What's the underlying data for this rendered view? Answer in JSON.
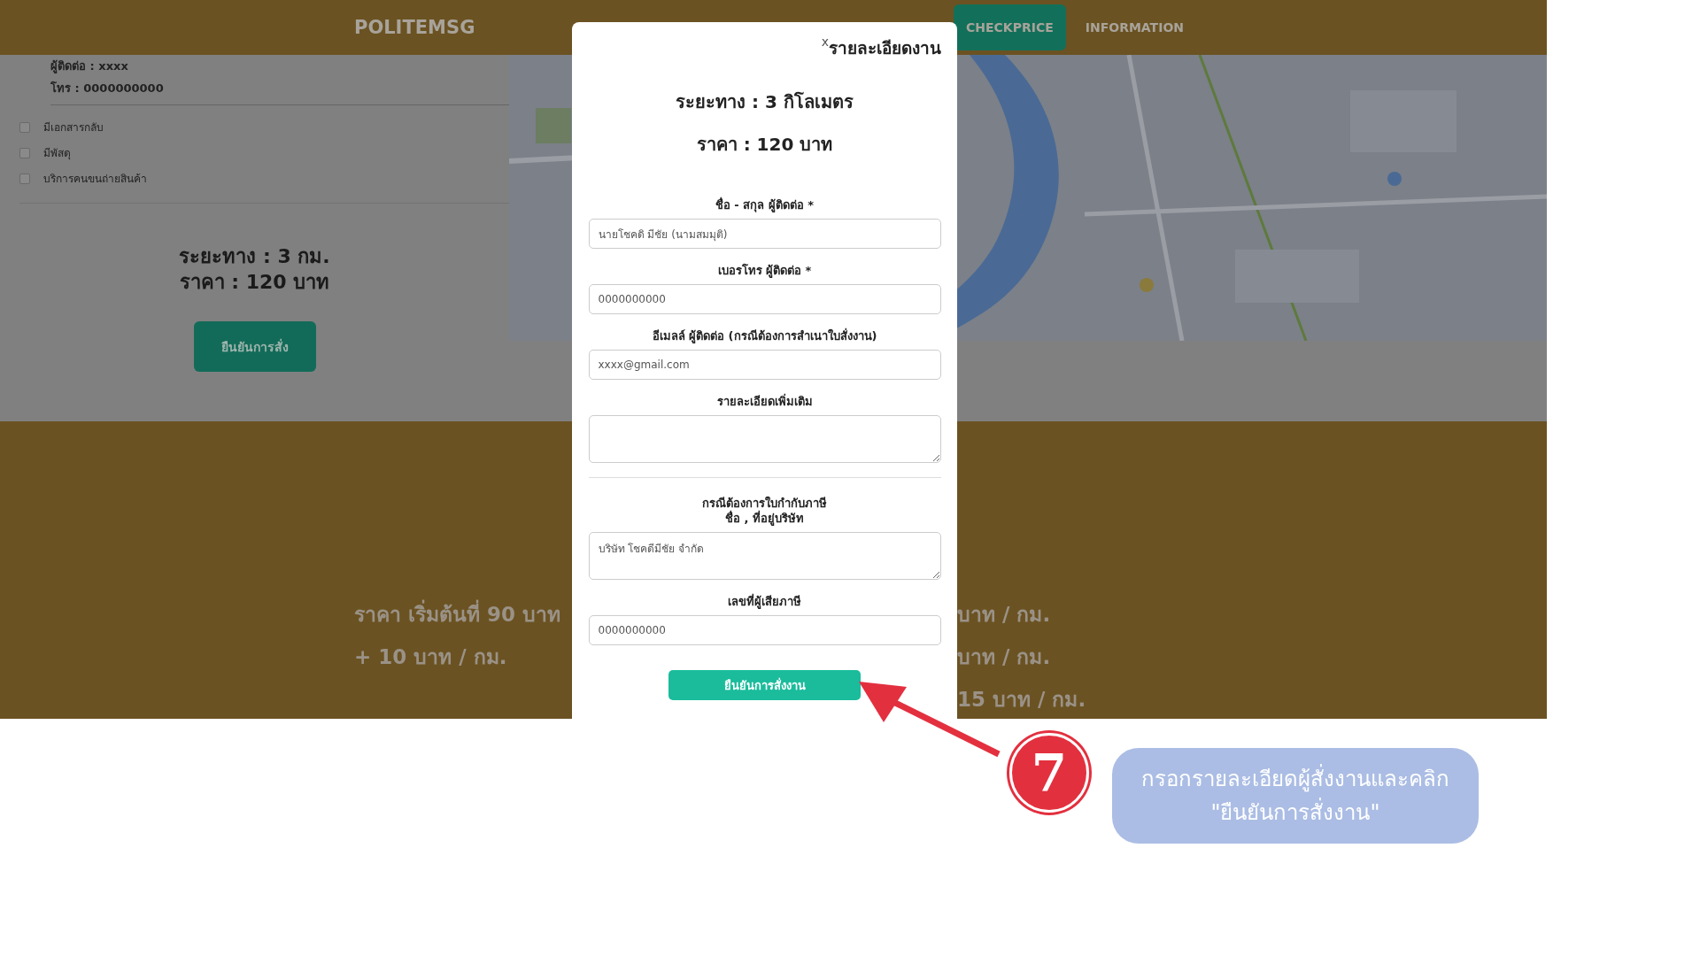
{
  "header": {
    "logo": "POLITEMSG",
    "nav": [
      {
        "label": "CHECKPRICE",
        "selected": true
      },
      {
        "label": "INFORMATION",
        "selected": false
      }
    ]
  },
  "contact": [
    "ผู้ติดต่อ : xxxx",
    "โทร : 0000000000"
  ],
  "options": [
    {
      "label": "มีเอกสารกลับ",
      "checked": false
    },
    {
      "label": "มีพัสดุ",
      "checked": false
    },
    {
      "label": "บริการคนขนถ่ายสินค้า",
      "checked": false
    }
  ],
  "summary": [
    "ระยะทาง : 3 กม.",
    "ราคา : 120 บาท"
  ],
  "confirm_button": "ยืนยันการสั่ง",
  "map": {
    "kind": "picture"
  },
  "pricing": {
    "left_lines": [
      "ราคา เริ่มต้นที่ 90 บาท",
      "+ 10 บาท / กม."
    ],
    "right_lines": [
      "บาท / กม.",
      "บาท / กม.",
      "15 บาท / กม."
    ]
  },
  "modal": {
    "close": "x",
    "title": "รายละเอียดงาน",
    "distance": "ระยะทาง : 3 กิโลเมตร",
    "price": "ราคา : 120 บาท",
    "fields": [
      {
        "label": "ชื่อ - สกุล ผู้ติดต่อ *",
        "kind": "input",
        "value": "นายโชคดิ มีชัย (นามสมมุติ)"
      },
      {
        "label": "เบอรโทร ผู้ติดต่อ *",
        "kind": "input",
        "value": "0000000000"
      },
      {
        "label": "อีเมลล์ ผู้ติดต่อ (กรณีต้องการสำเนาใบสั่งงาน)",
        "kind": "input",
        "value": "xxxx@gmail.com"
      },
      {
        "label": "รายละเอียดเพิ่มเติม",
        "kind": "textarea"
      },
      {
        "kind": "divider"
      },
      {
        "label": "กรณีต้องการใบกำกับภาษี\nชื่อ , ที่อยู่บริษัท",
        "kind": "textarea",
        "value": "บริษัท โชคดีมีชัย จำกัด"
      },
      {
        "label": "เลขที่ผู้เสียภาษี",
        "kind": "input",
        "value": "0000000000"
      }
    ],
    "submit": "ยืนยันการสั่งงาน"
  },
  "annotation": {
    "step": "7",
    "text": "กรอกรายละเอียดผู้สั่งงานและคลิก\n\"ยืนยันการสั่งงาน\""
  }
}
